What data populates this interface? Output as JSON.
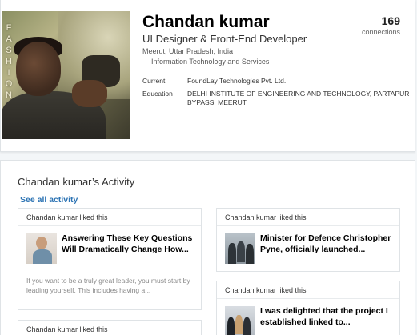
{
  "profile": {
    "photo_watermark": "FASHION",
    "name": "Chandan kumar",
    "headline": "UI Designer & Front-End Developer",
    "location": "Meerut, Uttar Pradesh, India",
    "industry": "Information Technology and Services",
    "connections_count": "169",
    "connections_label": "connections",
    "current_label": "Current",
    "current_value": "FoundLay Technologies Pvt. Ltd.",
    "education_label": "Education",
    "education_value": "DELHI INSTITUTE OF ENGINEERING AND TECHNOLOGY, PARTAPUR BYPASS, MEERUT"
  },
  "activity": {
    "title": "Chandan kumar’s Activity",
    "see_all": "See all activity",
    "cards": [
      {
        "header": "Chandan kumar liked this",
        "title": "Answering These Key Questions Will Dramatically Change How...",
        "description": "If you want to be a truly great leader, you must start by leading yourself. This includes having a..."
      },
      {
        "header": "Chandan kumar liked this",
        "title": "Minister for Defence Christopher Pyne, officially launched..."
      },
      {
        "header": "Chandan kumar liked this",
        "title": "I was delighted that the project I established linked to..."
      },
      {
        "header": "Chandan kumar liked this"
      }
    ]
  },
  "colors": {
    "link": "#2d74b4",
    "background": "#f3f6f8",
    "card_border": "#dfe3e6"
  }
}
